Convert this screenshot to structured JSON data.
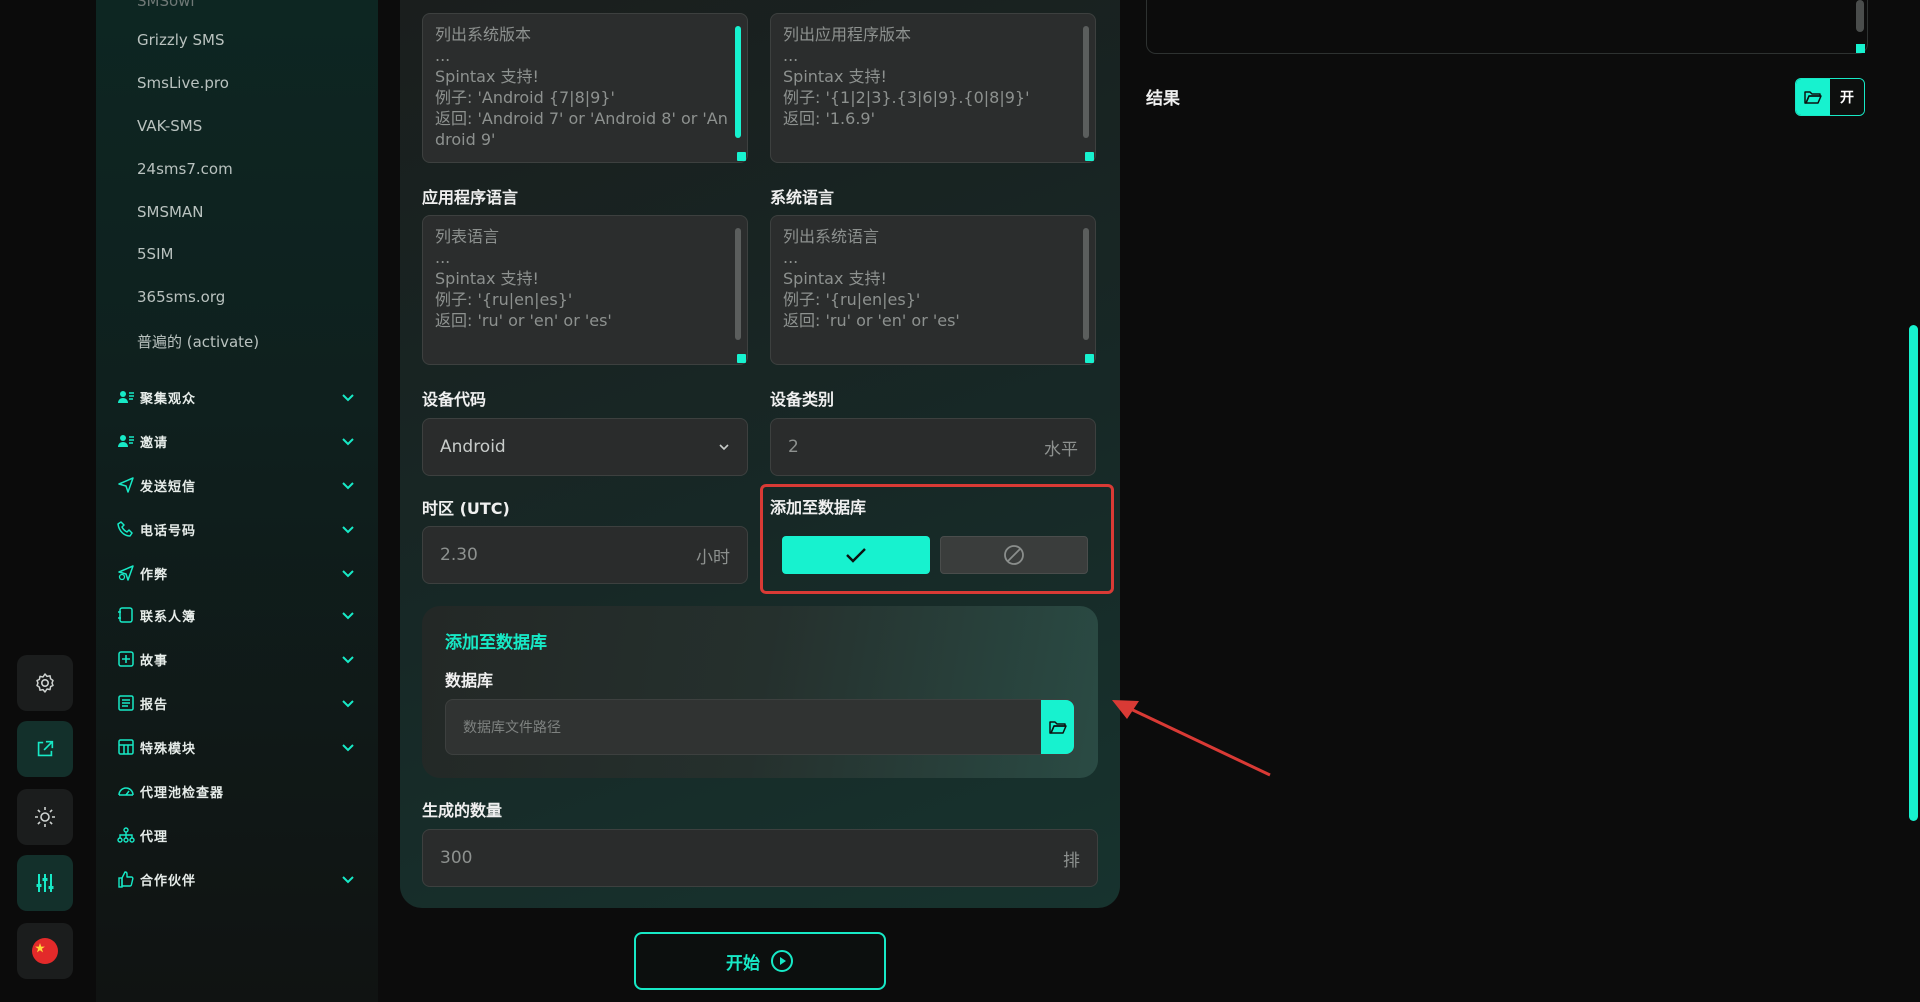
{
  "colors": {
    "accent": "#17f2cf",
    "highlight": "#d93a35",
    "background": "#0c0c0c"
  },
  "nav": {
    "providers": [
      "Grizzly SMS",
      "SmsLive.pro",
      "VAK-SMS",
      "24sms7.com",
      "SMSMAN",
      "5SIM",
      "365sms.org",
      "普遍的 (activate)"
    ],
    "sections": [
      {
        "label": "聚集观众",
        "icon": "users-icon"
      },
      {
        "label": "邀请",
        "icon": "user-add-icon"
      },
      {
        "label": "发送短信",
        "icon": "send-icon"
      },
      {
        "label": "电话号码",
        "icon": "phone-icon"
      },
      {
        "label": "作弊",
        "icon": "send-boost-icon"
      },
      {
        "label": "联系人簿",
        "icon": "contacts-book-icon"
      },
      {
        "label": "故事",
        "icon": "plus-square-icon"
      },
      {
        "label": "报告",
        "icon": "report-icon"
      },
      {
        "label": "特殊模块",
        "icon": "module-grid-icon"
      },
      {
        "label": "代理池检查器",
        "icon": "gauge-icon"
      },
      {
        "label": "代理",
        "icon": "network-icon"
      },
      {
        "label": "合作伙伴",
        "icon": "thumbs-up-icon"
      }
    ]
  },
  "form": {
    "system_version": {
      "lines": [
        "列出系统版本",
        "...",
        "Spintax 支持!",
        "例子: 'Android {7|8|9}'",
        "返回: 'Android 7' or 'Android 8' or 'Android 9'"
      ]
    },
    "app_version": {
      "lines": [
        "列出应用程序版本",
        "...",
        "Spintax 支持!",
        "例子: '{1|2|3}.{3|6|9}.{0|8|9}'",
        "返回: '1.6.9'"
      ]
    },
    "app_language": {
      "label": "应用程序语言",
      "lines": [
        "列表语言",
        "...",
        "Spintax 支持!",
        "例子: '{ru|en|es}'",
        "返回: 'ru' or 'en' or 'es'"
      ]
    },
    "system_language": {
      "label": "系统语言",
      "lines": [
        "列出系统语言",
        "...",
        "Spintax 支持!",
        "例子: '{ru|en|es}'",
        "返回: 'ru' or 'en' or 'es'"
      ]
    },
    "device_code": {
      "label": "设备代码",
      "value": "Android"
    },
    "device_category": {
      "label": "设备类别",
      "value": "2",
      "suffix": "水平"
    },
    "timezone": {
      "label": "时区 (UTC)",
      "value": "2.30",
      "suffix": "小时"
    },
    "add_to_db": {
      "label": "添加至数据库",
      "selected": "yes"
    },
    "db_card": {
      "title": "添加至数据库",
      "db_label": "数据库",
      "placeholder": "数据库文件路径"
    },
    "count": {
      "label": "生成的数量",
      "value": "300",
      "suffix": "排"
    }
  },
  "start_button": {
    "label": "开始"
  },
  "result": {
    "label": "结果",
    "toggle_label": "开"
  }
}
